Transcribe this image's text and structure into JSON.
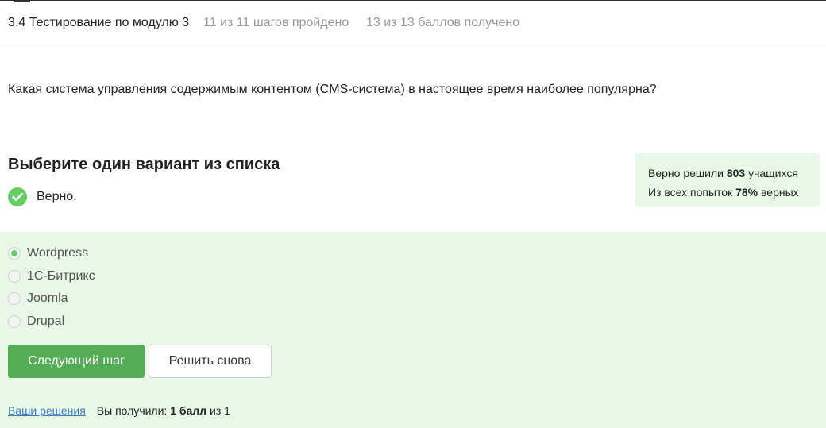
{
  "header": {
    "title": "3.4 Тестирование по модулю 3",
    "steps_status": "11 из 11 шагов пройдено",
    "points_status": "13 из 13 баллов  получено"
  },
  "question": {
    "text": "Какая система управления содержимым контентом (CMS-система) в настоящее время наиболее популярна?"
  },
  "quiz": {
    "instruction": "Выберите один вариант из списка",
    "verdict": "Верно.",
    "options": [
      {
        "label": "Wordpress",
        "selected": true
      },
      {
        "label": "1С-Битрикс",
        "selected": false
      },
      {
        "label": "Joomla",
        "selected": false
      },
      {
        "label": "Drupal",
        "selected": false
      }
    ]
  },
  "stats": {
    "solved_prefix": "Верно решили",
    "solved_count": "803",
    "solved_suffix": "учащихся",
    "attempts_prefix": "Из всех попыток",
    "attempts_percent": "78%",
    "attempts_suffix": "верных"
  },
  "actions": {
    "next_label": "Следующий шаг",
    "retry_label": "Решить снова"
  },
  "footer": {
    "solutions_link": "Ваши решения",
    "score_prefix": "Вы получили:",
    "score_value": "1 балл",
    "score_suffix": "из 1"
  },
  "colors": {
    "accent_green": "#54ad54",
    "success_bg": "#e9f7e9",
    "link_blue": "#3b7bbf"
  },
  "icons": {
    "verdict": "check-circle-icon",
    "radio_selected": "radio-checked-icon",
    "radio_unselected": "radio-unchecked-icon"
  }
}
